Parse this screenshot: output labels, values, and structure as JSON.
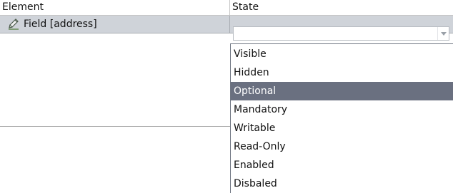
{
  "table": {
    "columns": {
      "element": "Element",
      "state": "State"
    },
    "rows": [
      {
        "element_label": "Field [address]",
        "icon": "pencil-icon",
        "state_value": ""
      }
    ]
  },
  "dropdown": {
    "options": [
      "Visible",
      "Hidden",
      "Optional",
      "Mandatory",
      "Writable",
      "Read-Only",
      "Enabled",
      "Disbaled"
    ],
    "selected": "Optional"
  },
  "colors": {
    "row_background": "#cfd3d9",
    "selected_option": "#6a7080",
    "selected_text": "#ffffff"
  }
}
